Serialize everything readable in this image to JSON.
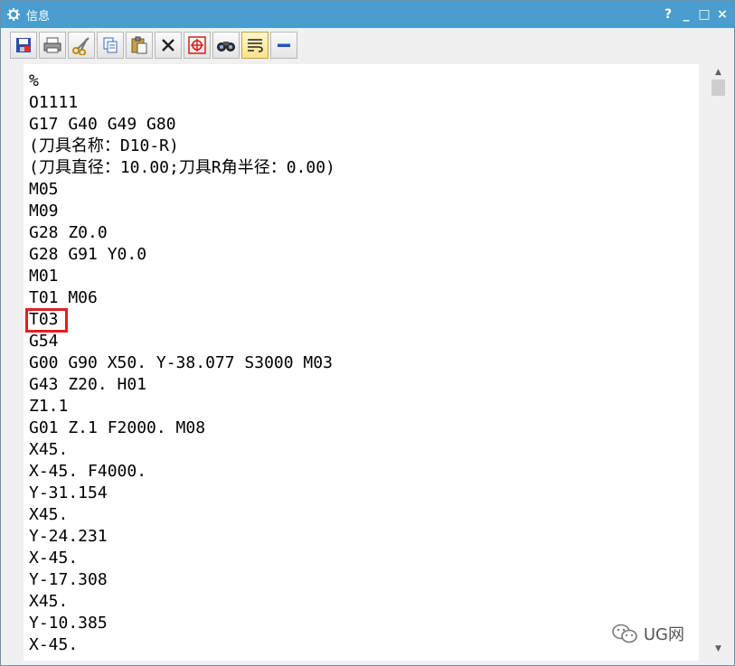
{
  "window": {
    "title": "信息",
    "controls": [
      "?",
      "_",
      "□",
      "×"
    ]
  },
  "toolbar": {
    "buttons": [
      {
        "icon": "save-icon"
      },
      {
        "icon": "print-icon"
      },
      {
        "icon": "cut-icon"
      },
      {
        "icon": "copy-icon"
      },
      {
        "icon": "paste-icon"
      },
      {
        "icon": "delete-icon"
      },
      {
        "icon": "target-icon"
      },
      {
        "icon": "find-icon"
      },
      {
        "icon": "wrap-icon"
      },
      {
        "icon": "minimize-icon"
      }
    ]
  },
  "code_lines": [
    "%",
    "O1111",
    "G17 G40 G49 G80",
    "(刀具名称：D10-R)",
    "(刀具直径：10.00;刀具R角半径：0.00)",
    "M05",
    "M09",
    "G28 Z0.0",
    "G28 G91 Y0.0",
    "M01",
    "T01 M06",
    "T03",
    "G54",
    "G00 G90 X50. Y-38.077 S3000 M03",
    "G43 Z20. H01",
    "Z1.1",
    "G01 Z.1 F2000. M08",
    "X45.",
    "X-45. F4000.",
    "Y-31.154",
    "X45.",
    "Y-24.231",
    "X-45.",
    "Y-17.308",
    "X45.",
    "Y-10.385",
    "X-45."
  ],
  "watermark": {
    "text": "UG网",
    "icon": "wechat-icon"
  },
  "colors": {
    "titlebar": "#4a9dce",
    "highlight": "#e02020"
  }
}
